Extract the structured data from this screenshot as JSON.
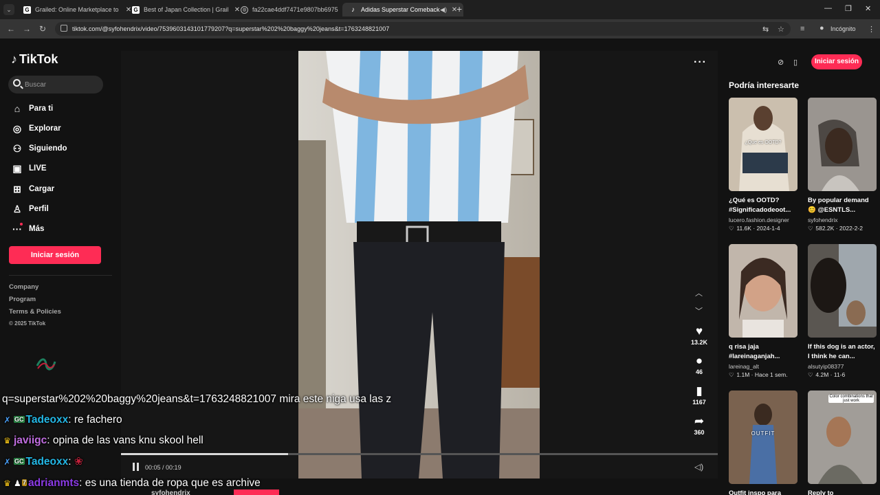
{
  "browser": {
    "tabs": [
      {
        "title": "Grailed: Online Marketplace to",
        "icon": "G"
      },
      {
        "title": "Best of Japan Collection | Grail",
        "icon": "G"
      },
      {
        "title": "fa22cae4ddf7471e9807bb6975",
        "icon": "globe-icon"
      },
      {
        "title": "Adidas Superstar Comeback",
        "icon": "tiktok-icon",
        "active": true
      }
    ],
    "url": "tiktok.com/@syfohendrix/video/7539603143101779207?q=superstar%202%20baggy%20jeans&t=1763248821007",
    "incognito_label": "Incógnito"
  },
  "sidebar": {
    "logo": "TikTok",
    "search_placeholder": "Buscar",
    "nav": [
      {
        "label": "Para ti",
        "icon": "home-icon"
      },
      {
        "label": "Explorar",
        "icon": "compass-icon"
      },
      {
        "label": "Siguiendo",
        "icon": "following-icon"
      },
      {
        "label": "LIVE",
        "icon": "live-icon"
      },
      {
        "label": "Cargar",
        "icon": "upload-icon"
      },
      {
        "label": "Perfil",
        "icon": "profile-icon"
      },
      {
        "label": "Más",
        "icon": "more-icon"
      }
    ],
    "login_label": "Iniciar sesión",
    "footer": [
      "Company",
      "Program",
      "Terms & Policies"
    ],
    "copyright": "© 2025 TikTok"
  },
  "player": {
    "current": "00:05",
    "duration": "00:19",
    "progress": 0.28,
    "actions": [
      {
        "icon": "heart-icon",
        "count": "13.2K"
      },
      {
        "icon": "comment-icon",
        "count": "46"
      },
      {
        "icon": "bookmark-icon",
        "count": "1167"
      },
      {
        "icon": "share-icon",
        "count": "360"
      }
    ]
  },
  "right": {
    "signin_label": "Iniciar sesión",
    "section_title": "Podría interesarte",
    "cards": [
      {
        "title": "¿Qué es OOTD? #Significadodeoot...",
        "user": "lucero.fashion.designer",
        "likes": "11.6K",
        "date": "2024-1-4",
        "caption": "¿Que es OOTD?"
      },
      {
        "title": "😊 @ESNTLS...",
        "title_top": "By popular demand",
        "user": "syfohendrix",
        "likes": "582.2K",
        "date": "2022-2-2",
        "caption": ""
      },
      {
        "title": "q risa jaja #lareinaganjah...",
        "user": "lareinag_alt",
        "likes": "1.1M",
        "date": "Hace 1 sem.",
        "caption": ""
      },
      {
        "title": "If this dog is an actor, I think he can...",
        "user": "alsutyip08377",
        "likes": "4.2M",
        "date": "11-6",
        "caption": ""
      },
      {
        "title": "Outfit inspo para",
        "user": "",
        "likes": "",
        "date": "",
        "caption": "OUTFIT"
      },
      {
        "title": "Reply to",
        "user": "",
        "likes": "",
        "date": "",
        "caption": "Color combinations that just work"
      }
    ]
  },
  "chat": {
    "lines": [
      {
        "user": "",
        "text": "q=superstar%202%20baggy%20jeans&t=1763248821007 mira este niga usa las z"
      },
      {
        "user": "Tadeoxx",
        "text": ": re fachero"
      },
      {
        "user": "javiigc",
        "text": ": opina de las vans knu skool hell"
      },
      {
        "user": "Tadeoxx",
        "text": ":"
      },
      {
        "user": "adrianmts",
        "text": ": es una tienda de ropa que es archive"
      }
    ],
    "cutoff_user": "syfohendrix"
  }
}
